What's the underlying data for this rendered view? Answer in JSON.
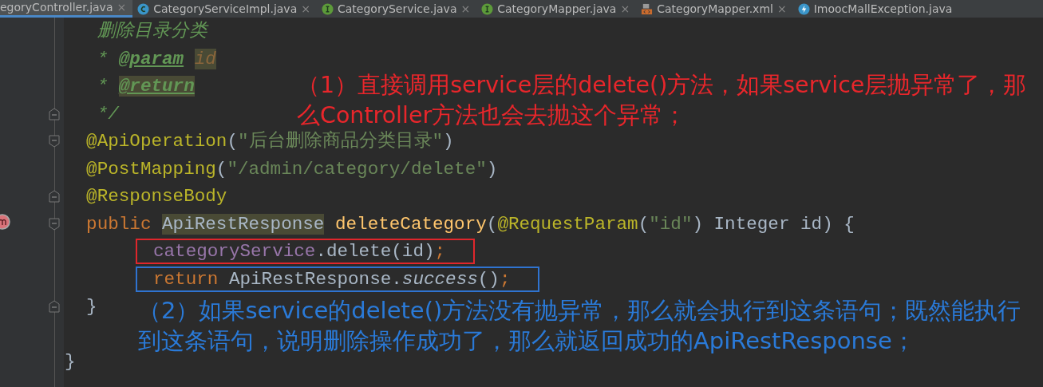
{
  "tabs": [
    {
      "label": "egoryController.java",
      "kind": "plain",
      "selected": true,
      "close": "×"
    },
    {
      "label": "CategoryServiceImpl.java",
      "kind": "class",
      "selected": false,
      "close": "×"
    },
    {
      "label": "CategoryService.java",
      "kind": "interface",
      "selected": false,
      "close": "×"
    },
    {
      "label": "CategoryMapper.java",
      "kind": "interface",
      "selected": false,
      "close": "×"
    },
    {
      "label": "CategoryMapper.xml",
      "kind": "xml",
      "selected": false,
      "close": "×"
    },
    {
      "label": "ImoocMallException.java",
      "kind": "exception",
      "selected": false
    }
  ],
  "lines": [
    {
      "tokens": [
        {
          "text": "   删除目录分类",
          "kind": "comment",
          "highlighted": false
        }
      ]
    },
    {
      "tokens": [
        {
          "text": "   *",
          "kind": "comment",
          "highlighted": false
        },
        {
          "text": "@param",
          "kind": "doctag",
          "highlighted": false
        },
        {
          "text": "id",
          "kind": "param",
          "highlighted": true
        }
      ]
    },
    {
      "tokens": [
        {
          "text": "   *",
          "kind": "comment",
          "highlighted": false
        },
        {
          "text": "@return",
          "kind": "doctag",
          "highlighted": true
        }
      ]
    },
    {
      "fold_end": true,
      "tokens": [
        {
          "text": "   */",
          "kind": "comment",
          "highlighted": false
        }
      ]
    },
    {
      "fold_start": true,
      "tokens": [
        {
          "text": "  @ApiOperation",
          "kind": "annotation",
          "highlighted": false
        },
        {
          "text": "(",
          "kind": "plain",
          "highlighted": false
        },
        {
          "text": "\"后台删除商品分类目录\"",
          "kind": "string",
          "highlighted": false
        },
        {
          "text": ")",
          "kind": "plain",
          "highlighted": false
        }
      ]
    },
    {
      "tokens": [
        {
          "text": "  @PostMapping",
          "kind": "annotation",
          "highlighted": false
        },
        {
          "text": "(",
          "kind": "plain",
          "highlighted": false
        },
        {
          "text": "\"/admin/category/delete\"",
          "kind": "string",
          "highlighted": false
        },
        {
          "text": ")",
          "kind": "plain",
          "highlighted": false
        }
      ]
    },
    {
      "fold_end": true,
      "tokens": [
        {
          "text": "  @ResponseBody",
          "kind": "annotation",
          "highlighted": false
        }
      ]
    },
    {
      "fold_start": true,
      "method_icon": true,
      "tokens": [
        {
          "text": "  public ",
          "kind": "keyword",
          "highlighted": false
        },
        {
          "text": "ApiRestResponse",
          "kind": "plain",
          "highlighted": true
        },
        {
          "text": " deleteCategory",
          "kind": "method",
          "highlighted": false
        },
        {
          "text": "(",
          "kind": "plain",
          "highlighted": false
        },
        {
          "text": "@RequestParam",
          "kind": "annotation",
          "highlighted": false
        },
        {
          "text": "(",
          "kind": "plain",
          "highlighted": false
        },
        {
          "text": "\"id\"",
          "kind": "string",
          "highlighted": false
        },
        {
          "text": ") Integer id) {",
          "kind": "plain",
          "highlighted": false
        }
      ]
    },
    {
      "color": "#e0262c",
      "tokens": [
        {
          "text": "categoryService",
          "kind": "field",
          "highlighted": false
        },
        {
          "text": ".delete(id)",
          "kind": "plain",
          "highlighted": false
        },
        {
          "text": ";",
          "kind": "keyword",
          "highlighted": false
        }
      ]
    },
    {
      "color": "#2f73d0",
      "tokens": [
        {
          "text": "return ",
          "kind": "keyword",
          "highlighted": false
        },
        {
          "text": "ApiRestResponse.",
          "kind": "plain",
          "highlighted": false
        },
        {
          "text": "success",
          "kind": "italic",
          "highlighted": false
        },
        {
          "text": "()",
          "kind": "plain",
          "highlighted": false
        },
        {
          "text": ";",
          "kind": "keyword",
          "highlighted": false
        }
      ]
    },
    {
      "fold_end": true,
      "tokens": [
        {
          "text": "  }",
          "kind": "plain",
          "highlighted": false
        }
      ]
    },
    {
      "gap_before": true,
      "tokens": [
        {
          "text": "}",
          "kind": "plain",
          "highlighted": false
        }
      ]
    }
  ],
  "notes": [
    {
      "lines": [
        "（1）直接调用service层的delete()方法，如果service层抛异常了，那",
        "么Controller方法也会去抛这个异常；"
      ],
      "color": "#e8262b"
    },
    {
      "lines": [
        "（2）如果service的delete()方法没有抛异常，那么就会执行到这条语句；既然能执行",
        "到这条语句，说明删除操作成功了，那么就返回成功的ApiRestResponse；"
      ],
      "color": "#2a7ad8"
    }
  ]
}
